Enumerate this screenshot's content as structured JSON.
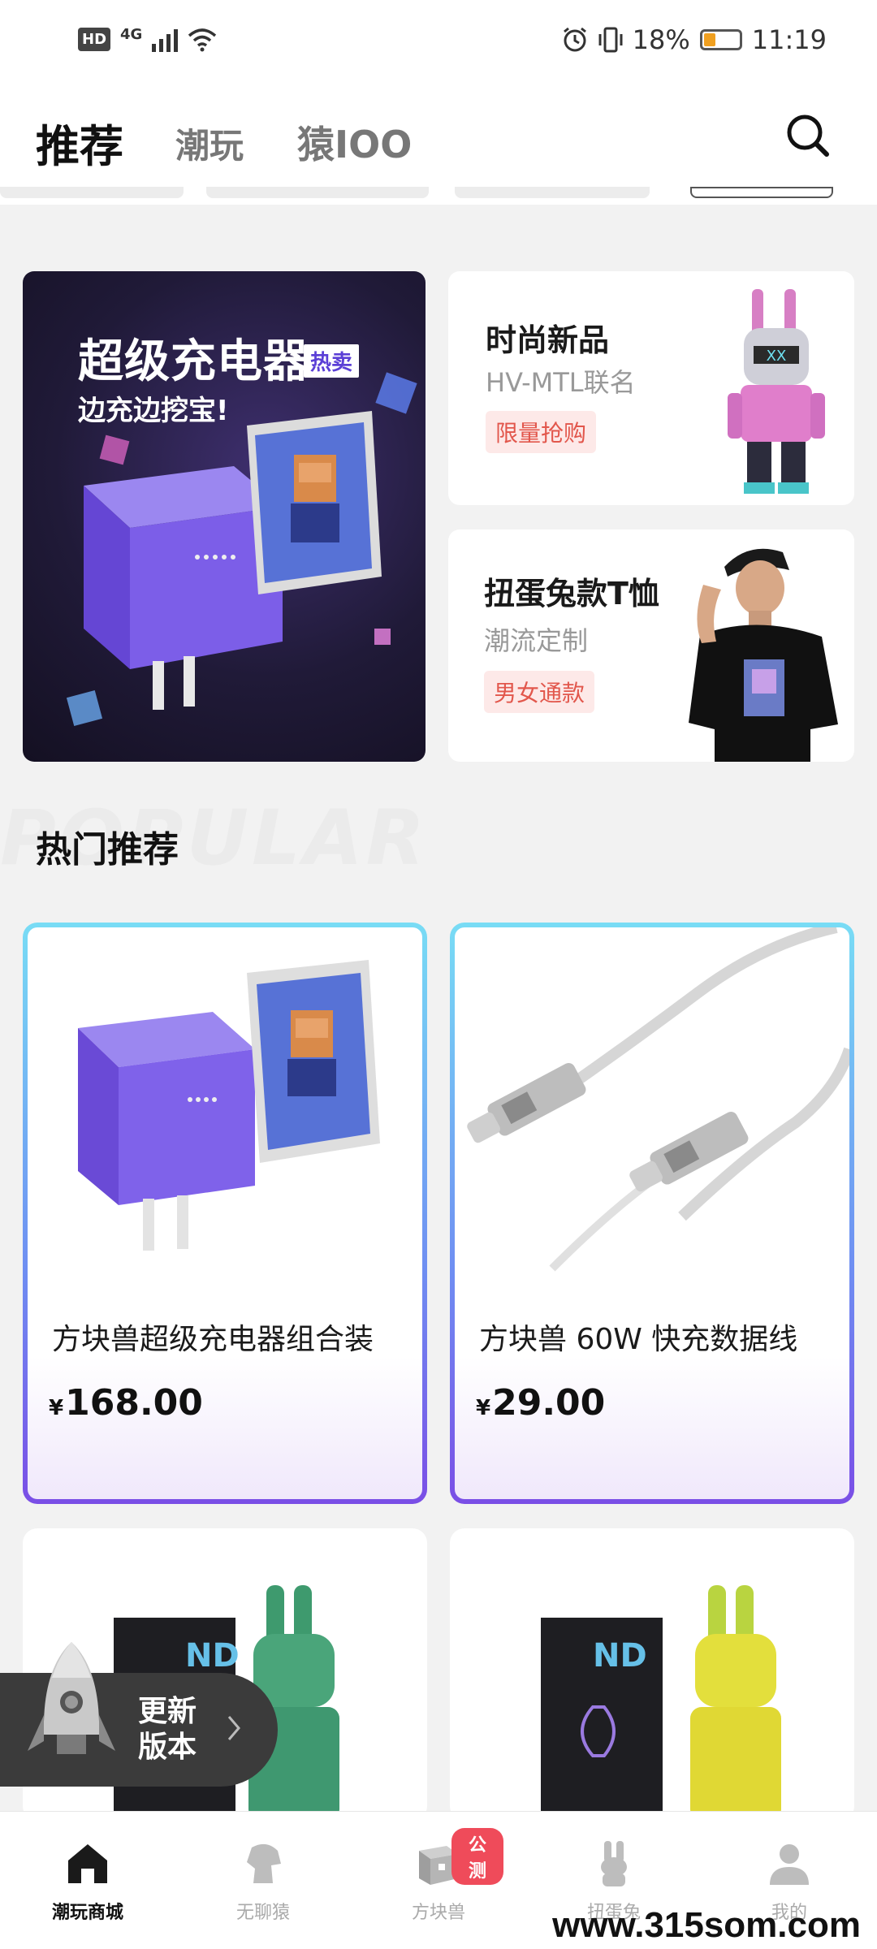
{
  "status_bar": {
    "hd": "HD",
    "network": "4G",
    "battery_text": "18%",
    "time": "11:19"
  },
  "header": {
    "tabs": [
      {
        "label": "推荐",
        "active": true
      },
      {
        "label": "潮玩",
        "active": false
      },
      {
        "label": "猿IOO",
        "active": false
      }
    ],
    "search_icon": "search-icon"
  },
  "banner": {
    "title": "超级充电器",
    "tag": "热卖",
    "subtitle": "边充边挖宝!"
  },
  "promos": [
    {
      "title": "时尚新品",
      "subtitle": "HV-MTL联名",
      "tag": "限量抢购"
    },
    {
      "title": "扭蛋兔款T恤",
      "subtitle": "潮流定制",
      "tag": "男女通款"
    }
  ],
  "section": {
    "ghost": "POPULAR",
    "title": "热门推荐"
  },
  "products": [
    {
      "name": "方块兽超级充电器组合装",
      "currency": "¥",
      "price": "168.00"
    },
    {
      "name": "方块兽 60W 快充数据线",
      "currency": "¥",
      "price": "29.00"
    }
  ],
  "update_button": {
    "label": "更新版本"
  },
  "bottom_nav": [
    {
      "label": "潮玩商城",
      "icon": "home-icon",
      "active": true
    },
    {
      "label": "无聊猿",
      "icon": "ape-icon",
      "active": false
    },
    {
      "label": "方块兽",
      "icon": "cube-beast-icon",
      "active": false,
      "badge": "公测"
    },
    {
      "label": "扭蛋兔",
      "icon": "rabbit-icon",
      "active": false
    },
    {
      "label": "我的",
      "icon": "profile-icon",
      "active": false
    }
  ],
  "watermark": "www.315som.com",
  "colors": {
    "accent_red": "#e2574c",
    "badge_red": "#ef4b5a",
    "card_border_top": "#78dcf5",
    "card_border_bottom": "#7a4ee6"
  }
}
